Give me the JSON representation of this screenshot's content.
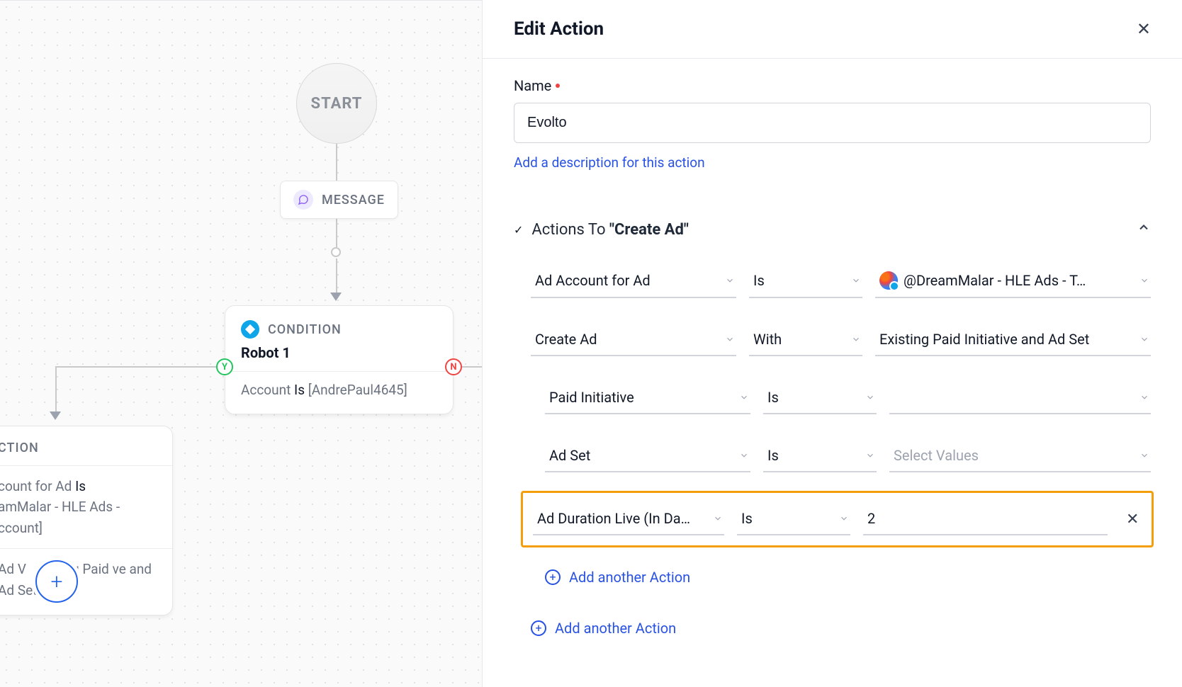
{
  "canvas": {
    "start_label": "START",
    "message_label": "MESSAGE",
    "condition": {
      "type_label": "CONDITION",
      "title": "Robot 1",
      "desc_prefix": "Account ",
      "desc_strong": "Is ",
      "desc_value": "[AndrePaul4645]",
      "yes": "Y",
      "no": "N"
    },
    "action": {
      "type_label": "CTION",
      "line1_a": "count for Ad ",
      "line1_b": "Is",
      "line2": "amMalar - HLE Ads - ccount]",
      "line3_a": " Ad V",
      "line3_b": "xisting Paid ve and Ad Set]"
    },
    "plus": "+"
  },
  "panel": {
    "title": "Edit Action",
    "name_label": "Name",
    "name_value": "Evolto",
    "add_desc": "Add a description for this action",
    "section_prefix": "Actions To ",
    "section_bold": "\"Create Ad\"",
    "rows": {
      "r1": {
        "c1": "Ad Account for Ad",
        "c2": "Is",
        "c3": "@DreamMalar - HLE Ads - T…"
      },
      "r2": {
        "c1": "Create Ad",
        "c2": "With",
        "c3": "Existing Paid Initiative and Ad Set"
      },
      "r3": {
        "c1": "Paid Initiative",
        "c2": "Is",
        "c3": ""
      },
      "r4": {
        "c1": "Ad Set",
        "c2": "Is",
        "c3_placeholder": "Select Values"
      },
      "r5": {
        "c1": "Ad Duration Live (In Da…",
        "c2": "Is",
        "c3": "2"
      }
    },
    "add_inner": "Add another Action",
    "add_outer": "Add another Action"
  }
}
